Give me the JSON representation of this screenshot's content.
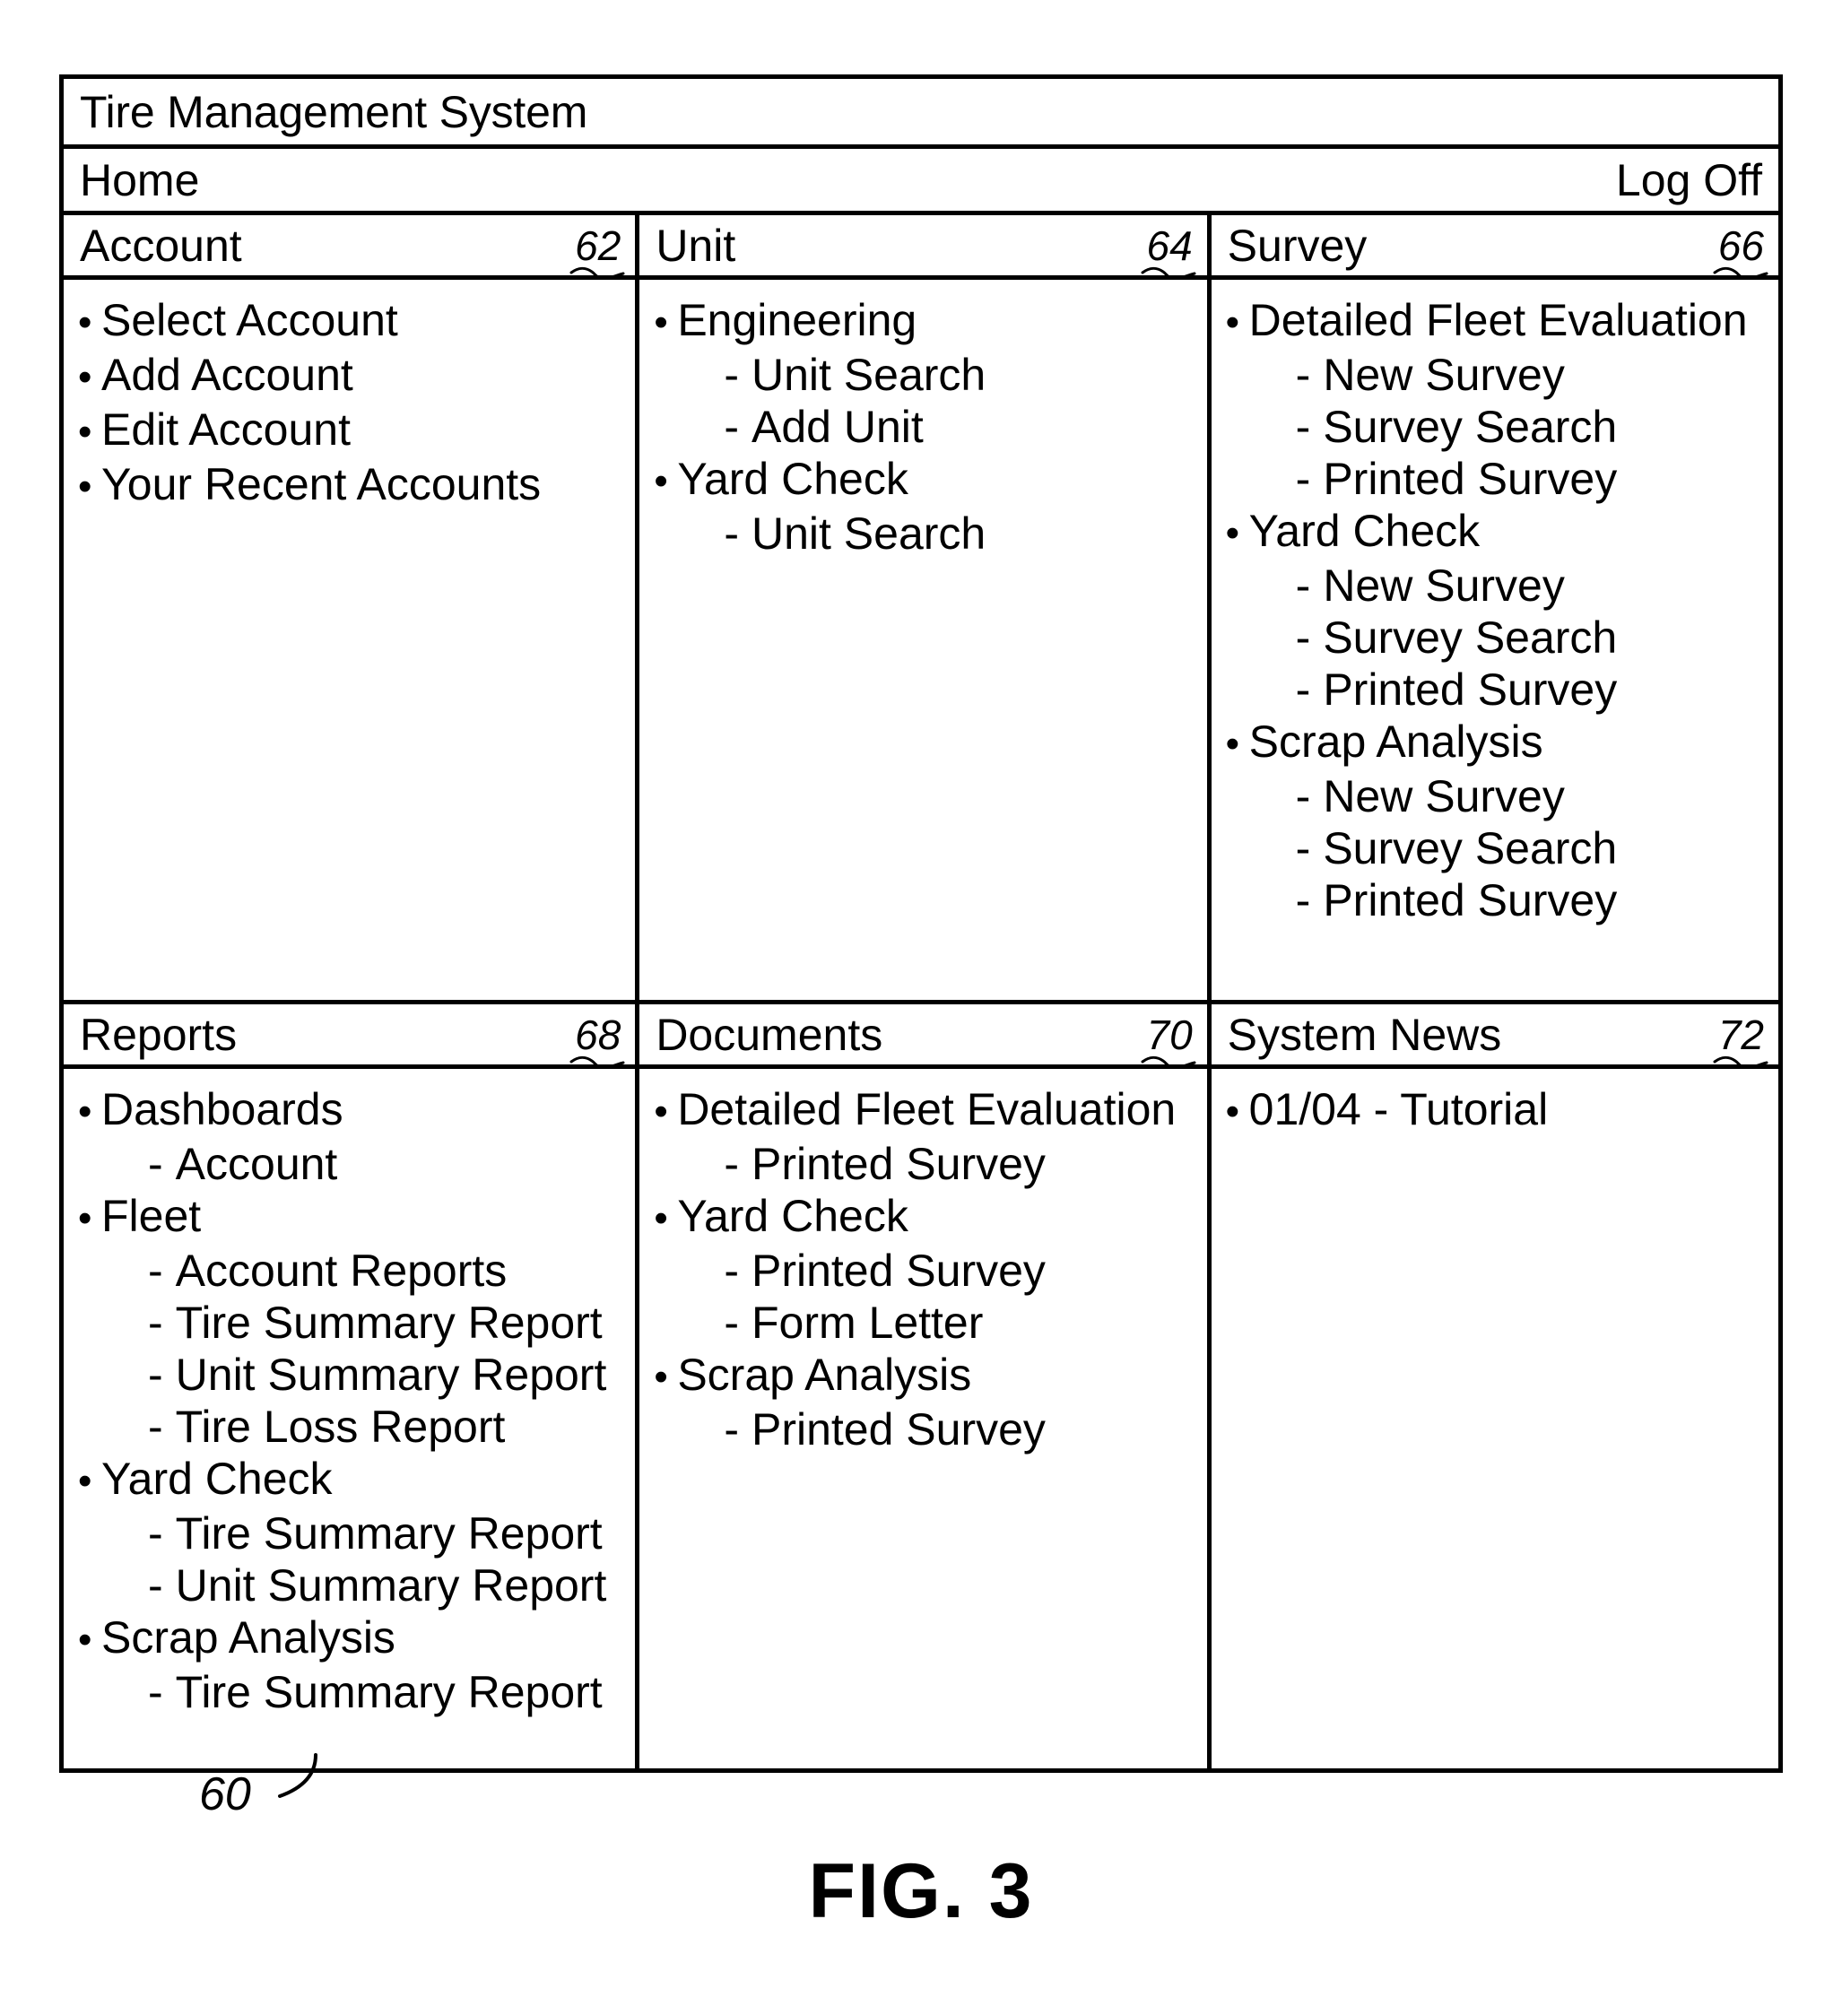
{
  "figure": {
    "caption": "FIG. 3",
    "diagram_ref": "60"
  },
  "window": {
    "title": "Tire Management System"
  },
  "nav": {
    "home_label": "Home",
    "logoff_label": "Log Off"
  },
  "panels": {
    "account": {
      "title": "Account",
      "ref": "62",
      "items": [
        {
          "level": 0,
          "label": "Select Account"
        },
        {
          "level": 0,
          "label": "Add Account"
        },
        {
          "level": 0,
          "label": "Edit Account"
        },
        {
          "level": 0,
          "label": "Your Recent Accounts"
        }
      ]
    },
    "unit": {
      "title": "Unit",
      "ref": "64",
      "items": [
        {
          "level": 0,
          "label": "Engineering"
        },
        {
          "level": 1,
          "label": "Unit Search"
        },
        {
          "level": 1,
          "label": "Add Unit"
        },
        {
          "level": 0,
          "label": "Yard Check"
        },
        {
          "level": 1,
          "label": "Unit Search"
        }
      ]
    },
    "survey": {
      "title": "Survey",
      "ref": "66",
      "items": [
        {
          "level": 0,
          "label": "Detailed Fleet Evaluation"
        },
        {
          "level": 1,
          "label": "New Survey"
        },
        {
          "level": 1,
          "label": "Survey Search"
        },
        {
          "level": 1,
          "label": "Printed Survey"
        },
        {
          "level": 0,
          "label": "Yard Check"
        },
        {
          "level": 1,
          "label": "New Survey"
        },
        {
          "level": 1,
          "label": "Survey Search"
        },
        {
          "level": 1,
          "label": "Printed Survey"
        },
        {
          "level": 0,
          "label": "Scrap Analysis"
        },
        {
          "level": 1,
          "label": "New Survey"
        },
        {
          "level": 1,
          "label": "Survey Search"
        },
        {
          "level": 1,
          "label": "Printed Survey"
        }
      ]
    },
    "reports": {
      "title": "Reports",
      "ref": "68",
      "items": [
        {
          "level": 0,
          "label": "Dashboards"
        },
        {
          "level": 1,
          "label": "Account"
        },
        {
          "level": 0,
          "label": "Fleet"
        },
        {
          "level": 1,
          "label": "Account Reports"
        },
        {
          "level": 1,
          "label": "Tire Summary Report"
        },
        {
          "level": 1,
          "label": "Unit Summary Report"
        },
        {
          "level": 1,
          "label": "Tire Loss Report"
        },
        {
          "level": 0,
          "label": "Yard Check"
        },
        {
          "level": 1,
          "label": "Tire Summary Report"
        },
        {
          "level": 1,
          "label": "Unit Summary Report"
        },
        {
          "level": 0,
          "label": "Scrap Analysis"
        },
        {
          "level": 1,
          "label": "Tire Summary Report"
        }
      ]
    },
    "documents": {
      "title": "Documents",
      "ref": "70",
      "items": [
        {
          "level": 0,
          "label": "Detailed Fleet Evaluation"
        },
        {
          "level": 1,
          "label": "Printed Survey"
        },
        {
          "level": 0,
          "label": "Yard Check"
        },
        {
          "level": 1,
          "label": "Printed Survey"
        },
        {
          "level": 1,
          "label": "Form Letter"
        },
        {
          "level": 0,
          "label": "Scrap Analysis"
        },
        {
          "level": 1,
          "label": "Printed Survey"
        }
      ]
    },
    "system_news": {
      "title": "System News",
      "ref": "72",
      "items": [
        {
          "level": 0,
          "label": "01/04 - Tutorial"
        }
      ]
    }
  },
  "glyphs": {
    "bullet": "•",
    "dash": "-"
  }
}
